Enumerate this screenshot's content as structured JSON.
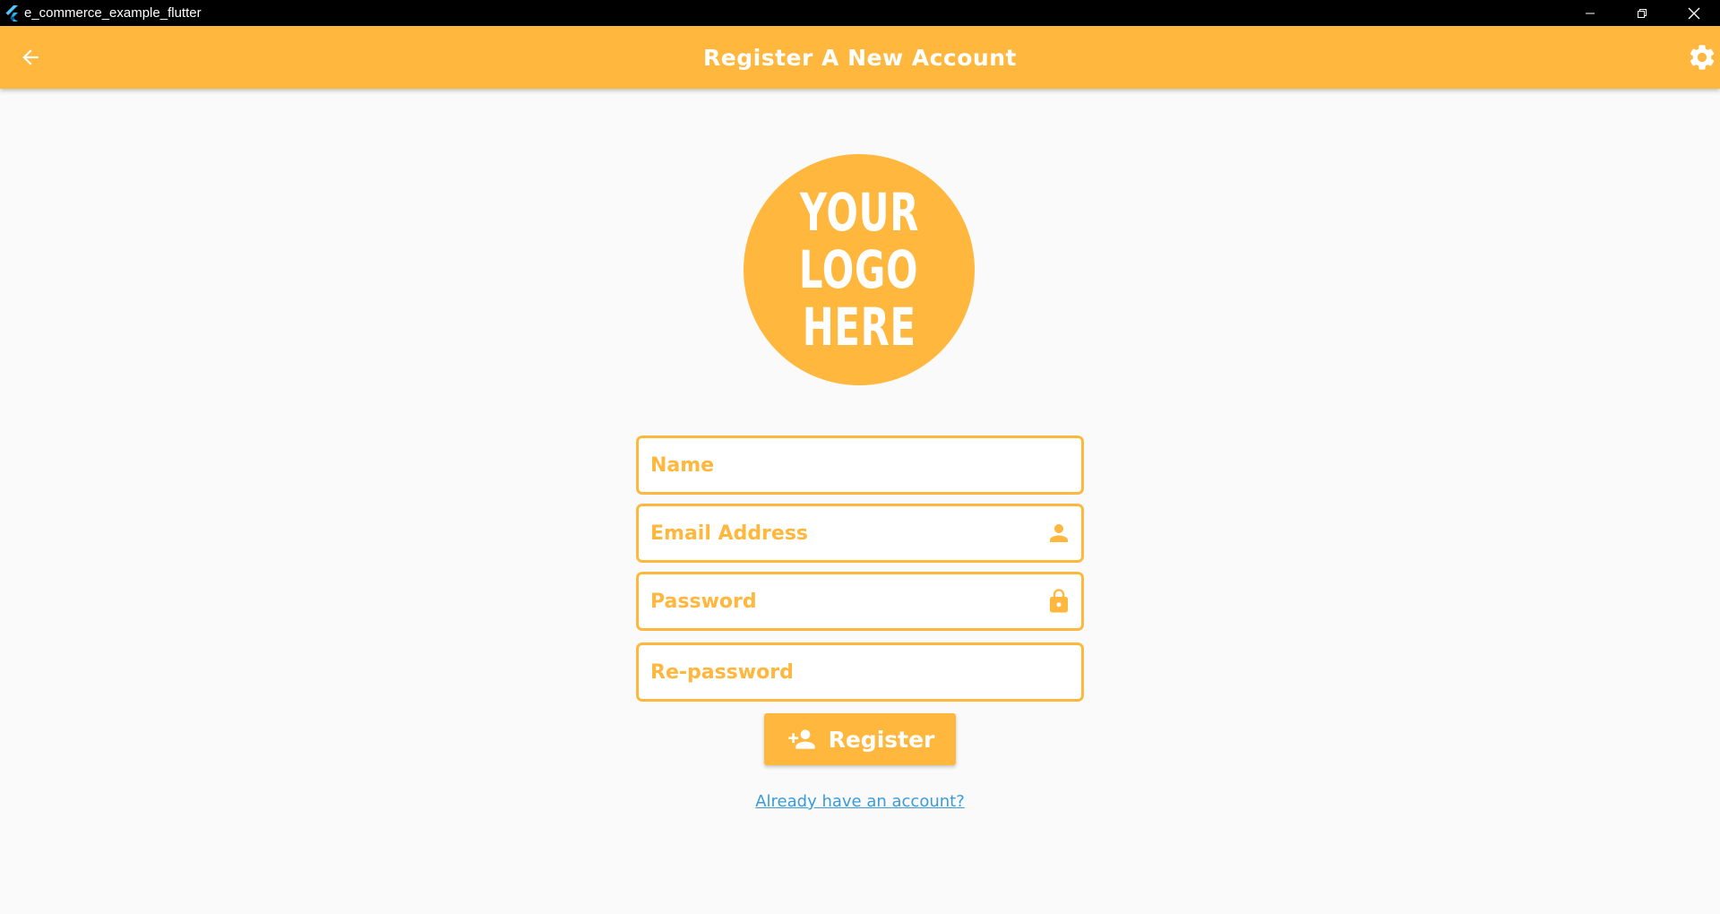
{
  "window": {
    "title": "e_commerce_example_flutter",
    "controls": [
      "minimize-icon",
      "restore-icon",
      "close-icon"
    ]
  },
  "appbar": {
    "title": "Register A New Account",
    "back_icon": "arrow-left-icon",
    "settings_icon": "gear-icon",
    "color": "#ffb73d"
  },
  "logo": {
    "lines": [
      "YOUR",
      "LOGO",
      "HERE"
    ],
    "color": "#ffb73d"
  },
  "form": {
    "name_placeholder": "Name",
    "email_placeholder": "Email Address",
    "email_icon": "person-icon",
    "password_placeholder": "Password",
    "password_icon": "lock-icon",
    "repassword_placeholder": "Re-password",
    "register_label": "Register",
    "register_icon": "person-add-icon",
    "login_link": "Already have an account?"
  },
  "colors": {
    "accent": "#ffb73d",
    "link": "#3a9bd6",
    "background": "#fafafa"
  }
}
